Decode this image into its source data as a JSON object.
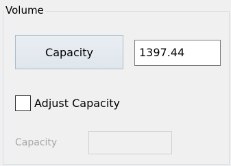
{
  "group": {
    "title": "Volume"
  },
  "capacity_button": {
    "label": "Capacity"
  },
  "capacity_value": {
    "value": "1397.44"
  },
  "adjust_checkbox": {
    "label": "Adjust Capacity",
    "checked": false
  },
  "adjusted_capacity": {
    "label": "Capacity",
    "value": ""
  }
}
